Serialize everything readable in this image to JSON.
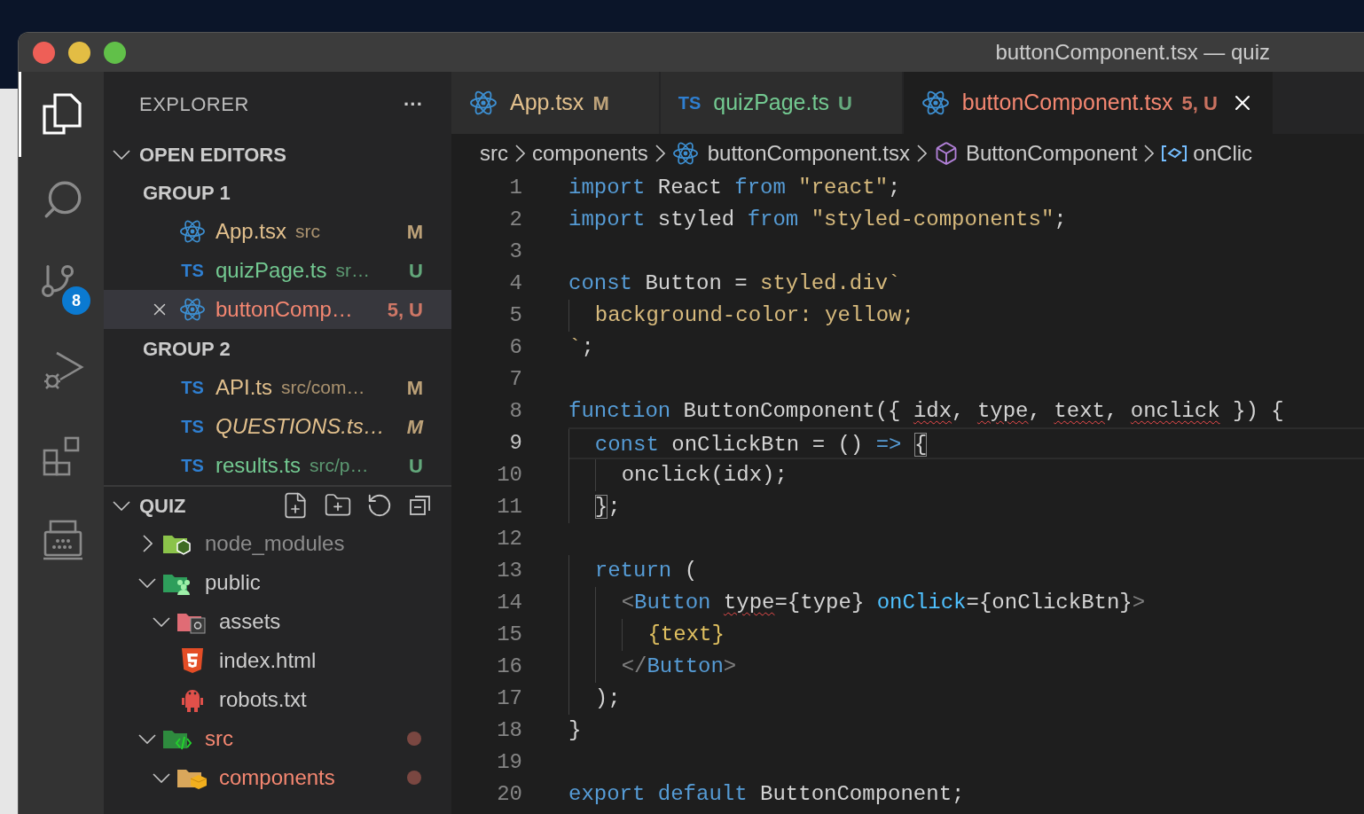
{
  "window": {
    "title": "buttonComponent.tsx — quiz"
  },
  "activity_bar": [
    {
      "kind": "explorer",
      "selected": true
    },
    {
      "kind": "search",
      "selected": false
    },
    {
      "kind": "source-control",
      "selected": false,
      "badge": "8"
    },
    {
      "kind": "run-debug",
      "selected": false
    },
    {
      "kind": "extensions",
      "selected": false
    },
    {
      "kind": "typewriter",
      "selected": false
    }
  ],
  "sidebar": {
    "title": "EXPLORER",
    "more": "···",
    "open_editors": {
      "title": "OPEN EDITORS",
      "expanded": true,
      "groups": [
        {
          "title": "GROUP 1",
          "items": [
            {
              "kind": "react",
              "name": "App.tsx",
              "path": "src",
              "status": "M",
              "color": "#e2c08d",
              "italic": false,
              "selected": false
            },
            {
              "kind": "ts",
              "icon_label": "TS",
              "name": "quizPage.ts",
              "path": "sr…",
              "status": "U",
              "color": "#73c991",
              "italic": false,
              "selected": false
            },
            {
              "kind": "react",
              "name": "buttonComp…",
              "status": "5, U",
              "color": "#f48771",
              "italic": false,
              "selected": true
            }
          ]
        },
        {
          "title": "GROUP 2",
          "items": [
            {
              "kind": "ts",
              "icon_label": "TS",
              "name": "API.ts",
              "path": "src/com…",
              "status": "M",
              "color": "#e2c08d",
              "italic": false,
              "selected": false
            },
            {
              "kind": "ts",
              "icon_label": "TS",
              "name": "QUESTIONS.ts…",
              "status": "M",
              "color": "#e2c08d",
              "italic": true,
              "selected": false
            },
            {
              "kind": "ts",
              "icon_label": "TS",
              "name": "results.ts",
              "path": "src/p…",
              "status": "U",
              "color": "#73c991",
              "italic": false,
              "selected": false
            }
          ]
        }
      ]
    },
    "folder": {
      "title": "QUIZ",
      "expanded": true,
      "items": [
        {
          "kind": "folder-node",
          "name": "node_modules",
          "expanded": false,
          "changes": false,
          "color": "#8c8c8c"
        },
        {
          "kind": "folder-public",
          "name": "public",
          "expanded": true,
          "changes": false,
          "color": "#cccccc",
          "children": [
            {
              "kind": "folder-assets",
              "name": "assets",
              "expanded": true,
              "changes": false,
              "color": "#cccccc"
            },
            {
              "kind": "html",
              "name": "index.html",
              "changes": false,
              "color": "#cccccc"
            },
            {
              "kind": "robot",
              "name": "robots.txt",
              "changes": false,
              "color": "#cccccc"
            }
          ]
        },
        {
          "kind": "folder-src",
          "name": "src",
          "expanded": true,
          "changes": true,
          "color": "#f48771",
          "children": [
            {
              "kind": "folder-components",
              "name": "components",
              "expanded": true,
              "changes": true,
              "color": "#f48771"
            }
          ]
        }
      ]
    }
  },
  "tabs": [
    {
      "kind": "react",
      "name": "App.tsx",
      "status": "M",
      "color": "#e2c08d",
      "selected": false
    },
    {
      "kind": "ts",
      "icon_label": "TS",
      "name": "quizPage.ts",
      "status": "U",
      "color": "#73c991",
      "selected": false
    },
    {
      "kind": "react",
      "name": "buttonComponent.tsx",
      "status": "5, U",
      "color": "#f48771",
      "selected": true
    }
  ],
  "breadcrumb": [
    {
      "kind": "folder",
      "text": "src"
    },
    {
      "kind": "folder",
      "text": "components"
    },
    {
      "kind": "react",
      "text": "buttonComponent.tsx"
    },
    {
      "kind": "class",
      "text": "ButtonComponent"
    },
    {
      "kind": "variable",
      "text": "onClic"
    }
  ],
  "code_lines": [
    {
      "number": "1",
      "selected": false,
      "tokens": [
        {
          "text": "import",
          "kind": "keyword"
        },
        {
          "text": " React ",
          "kind": "plain"
        },
        {
          "text": "from",
          "kind": "keyword"
        },
        {
          "text": " \"react\"",
          "kind": "string"
        },
        {
          "text": ";",
          "kind": "plain"
        }
      ]
    },
    {
      "number": "2",
      "selected": false,
      "tokens": [
        {
          "text": "import",
          "kind": "keyword"
        },
        {
          "text": " styled ",
          "kind": "plain"
        },
        {
          "text": "from",
          "kind": "keyword"
        },
        {
          "text": " \"styled-components\"",
          "kind": "string"
        },
        {
          "text": ";",
          "kind": "plain"
        }
      ]
    },
    {
      "number": "3",
      "selected": false
    },
    {
      "number": "4",
      "selected": false,
      "tokens": [
        {
          "text": "const",
          "kind": "keyword"
        },
        {
          "text": " Button = ",
          "kind": "plain"
        },
        {
          "text": "styled.div`",
          "kind": "string"
        }
      ]
    },
    {
      "number": "5",
      "selected": false,
      "tokens": [
        {
          "text": "  background-color: yellow;",
          "kind": "string"
        }
      ]
    },
    {
      "number": "6",
      "selected": false,
      "tokens": [
        {
          "text": "`",
          "kind": "string"
        },
        {
          "text": ";",
          "kind": "plain"
        }
      ]
    },
    {
      "number": "7",
      "selected": false
    },
    {
      "number": "8",
      "selected": false,
      "tokens": [
        {
          "text": "function",
          "kind": "keyword"
        },
        {
          "text": " ButtonComponent({ ",
          "kind": "plain"
        },
        {
          "text": "idx",
          "kind": "error"
        },
        {
          "text": ", ",
          "kind": "plain"
        },
        {
          "text": "type",
          "kind": "error"
        },
        {
          "text": ", ",
          "kind": "plain"
        },
        {
          "text": "text",
          "kind": "error"
        },
        {
          "text": ", ",
          "kind": "plain"
        },
        {
          "text": "onclick",
          "kind": "error"
        },
        {
          "text": " }) {",
          "kind": "plain"
        }
      ]
    },
    {
      "number": "9",
      "selected": true,
      "tokens": [
        {
          "text": "  const",
          "kind": "keyword"
        },
        {
          "text": " onClickBtn = () ",
          "kind": "plain"
        },
        {
          "text": "=> ",
          "kind": "keyword"
        },
        {
          "text": "{",
          "kind": "match"
        }
      ]
    },
    {
      "number": "10",
      "selected": false,
      "tokens": [
        {
          "text": "    onclick(idx);",
          "kind": "plain"
        }
      ]
    },
    {
      "number": "11",
      "selected": false,
      "tokens": [
        {
          "text": "  }",
          "kind": "match"
        },
        {
          "text": ";",
          "kind": "plain"
        }
      ]
    },
    {
      "number": "12",
      "selected": false
    },
    {
      "number": "13",
      "selected": false,
      "tokens": [
        {
          "text": "  return",
          "kind": "keyword"
        },
        {
          "text": " (",
          "kind": "plain"
        }
      ]
    },
    {
      "number": "14",
      "selected": false,
      "tokens": [
        {
          "text": "    <",
          "kind": "punct"
        },
        {
          "text": "Button ",
          "kind": "tag"
        },
        {
          "text": "type",
          "kind": "error"
        },
        {
          "text": "={type} ",
          "kind": "plain"
        },
        {
          "text": "onClick",
          "kind": "attribute"
        },
        {
          "text": "={onClickBtn}",
          "kind": "plain"
        },
        {
          "text": ">",
          "kind": "punct"
        }
      ]
    },
    {
      "number": "15",
      "selected": false,
      "tokens": [
        {
          "text": "      {text}",
          "kind": "brace"
        }
      ]
    },
    {
      "number": "16",
      "selected": false,
      "tokens": [
        {
          "text": "    </",
          "kind": "punct"
        },
        {
          "text": "Button",
          "kind": "tag"
        },
        {
          "text": ">",
          "kind": "punct"
        }
      ]
    },
    {
      "number": "17",
      "selected": false,
      "tokens": [
        {
          "text": "  );",
          "kind": "plain"
        }
      ]
    },
    {
      "number": "18",
      "selected": false,
      "tokens": [
        {
          "text": "}",
          "kind": "plain"
        }
      ]
    },
    {
      "number": "19",
      "selected": false
    },
    {
      "number": "20",
      "selected": false,
      "tokens": [
        {
          "text": "export default",
          "kind": "keyword"
        },
        {
          "text": " ButtonComponent;",
          "kind": "plain"
        }
      ]
    }
  ]
}
